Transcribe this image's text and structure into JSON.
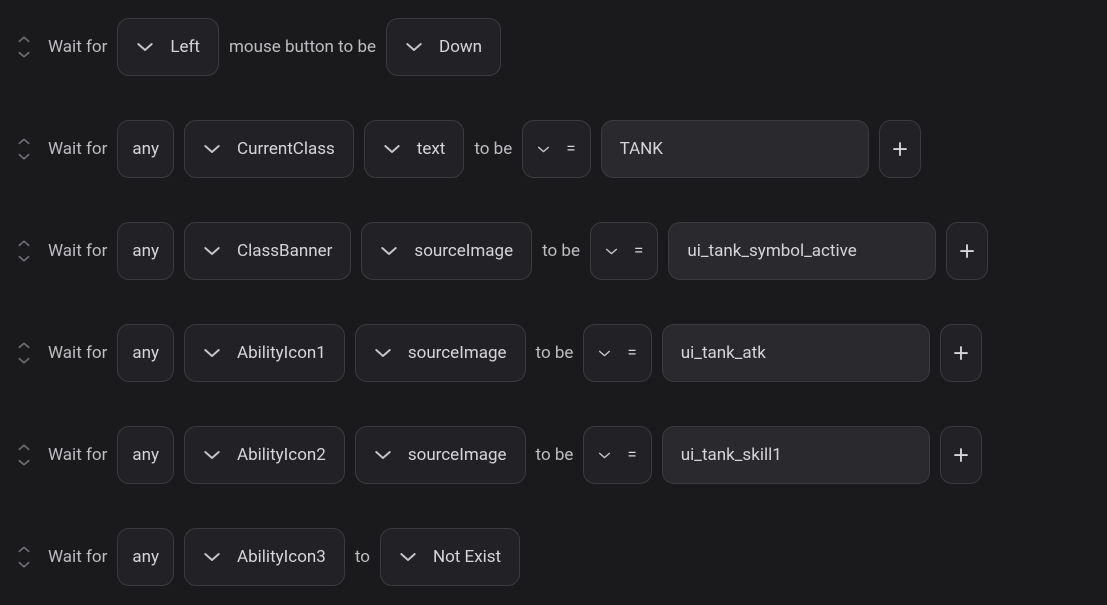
{
  "labels": {
    "wait_for": "Wait for",
    "mouse_button_to_be": "mouse button to be",
    "to_be": "to be",
    "to": "to",
    "any": "any"
  },
  "rows": [
    {
      "kind": "mouse",
      "button": "Left",
      "state": "Down"
    },
    {
      "kind": "prop",
      "target": "CurrentClass",
      "property": "text",
      "operator": "=",
      "value": "TANK",
      "value_width": 268
    },
    {
      "kind": "prop",
      "target": "ClassBanner",
      "property": "sourceImage",
      "operator": "=",
      "value": "ui_tank_symbol_active",
      "value_width": 268
    },
    {
      "kind": "prop",
      "target": "AbilityIcon1",
      "property": "sourceImage",
      "operator": "=",
      "value": "ui_tank_atk",
      "value_width": 268
    },
    {
      "kind": "prop",
      "target": "AbilityIcon2",
      "property": "sourceImage",
      "operator": "=",
      "value": "ui_tank_skill1",
      "value_width": 268
    },
    {
      "kind": "exist",
      "target": "AbilityIcon3",
      "state": "Not Exist"
    }
  ]
}
